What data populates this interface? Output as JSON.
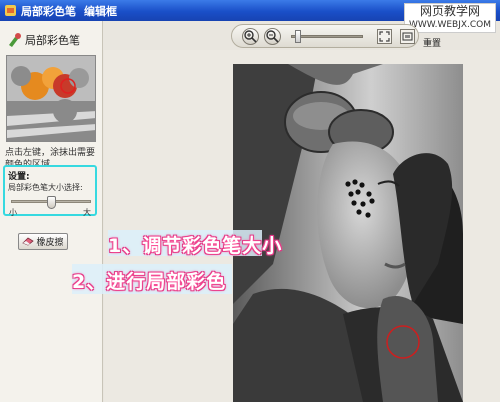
{
  "window": {
    "title": "局部彩色笔",
    "subtitle": "编辑框"
  },
  "watermark": {
    "line1": "网页教学网",
    "line2": "WWW.WEBJX.COM"
  },
  "panel": {
    "title": "局部彩色笔",
    "hint": "点击左键，涂抹出需要颜色的区域",
    "settings": {
      "title": "设置:",
      "size_label": "局部彩色笔大小选择:",
      "min_label": "小",
      "max_label": "大",
      "size_value": 0.5
    },
    "eraser_label": "橡皮擦"
  },
  "toolbar": {
    "zoom_in_icon": "zoom-in-icon",
    "zoom_out_icon": "zoom-out-icon",
    "zoom_level": 0.05,
    "fit_icon": "fit-screen-icon",
    "actual_size_icon": "actual-size-icon",
    "reset_label": "重置"
  },
  "annotations": {
    "step1": "1、调节彩色笔大小",
    "step2": "2、进行局部彩色"
  },
  "colors": {
    "titlebar": "#1a4fc8",
    "settings_border": "#36d9e0",
    "annotation_glow": "#ff5a9e",
    "brush_circle": "#cc1f1f"
  }
}
